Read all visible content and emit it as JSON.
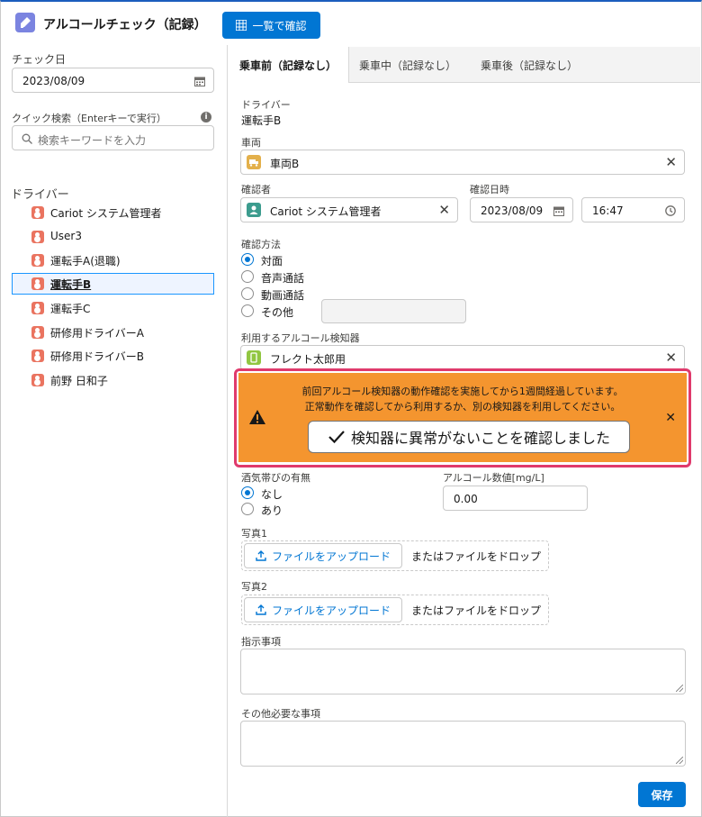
{
  "header": {
    "title": "アルコールチェック（記録）",
    "list_button": "一覧で確認"
  },
  "left": {
    "check_date_label": "チェック日",
    "check_date_value": "2023/08/09",
    "quick_search_label": "クイック検索（Enterキーで実行）",
    "search_placeholder": "検索キーワードを入力",
    "drivers_title": "ドライバー",
    "drivers": [
      {
        "name": "Cariot システム管理者",
        "selected": false
      },
      {
        "name": "User3",
        "selected": false
      },
      {
        "name": "運転手A(退職)",
        "selected": false
      },
      {
        "name": "運転手B",
        "selected": true
      },
      {
        "name": "運転手C",
        "selected": false
      },
      {
        "name": "研修用ドライバーA",
        "selected": false
      },
      {
        "name": "研修用ドライバーB",
        "selected": false
      },
      {
        "name": "前野 日和子",
        "selected": false
      }
    ]
  },
  "tabs": [
    "乗車前（記録なし）",
    "乗車中（記録なし）",
    "乗車後（記録なし）"
  ],
  "form": {
    "driver_label": "ドライバー",
    "driver_value": "運転手B",
    "vehicle_label": "車両",
    "vehicle_value": "車両B",
    "confirmer_label": "確認者",
    "confirmer_value": "Cariot システム管理者",
    "confirm_datetime_label": "確認日時",
    "confirm_date": "2023/08/09",
    "confirm_time": "16:47",
    "method_label": "確認方法",
    "methods": [
      "対面",
      "音声通話",
      "動画通話",
      "その他"
    ],
    "method_selected": "対面",
    "detector_label": "利用するアルコール検知器",
    "detector_value": "フレクト太郎用",
    "warning_line1": "前回アルコール検知器の動作確認を実施してから1週間経過しています。",
    "warning_line2": "正常動作を確認してから利用するか、別の検知器を利用してください。",
    "warning_button": "検知器に異常がないことを確認しました",
    "alcohol_presence_label": "酒気帯びの有無",
    "alcohol_options": [
      "なし",
      "あり"
    ],
    "alcohol_selected": "なし",
    "alcohol_value_label": "アルコール数値[mg/L]",
    "alcohol_value": "0.00",
    "photo1_label": "写真1",
    "photo2_label": "写真2",
    "upload_button": "ファイルをアップロード",
    "drop_text": "またはファイルをドロップ",
    "instructions_label": "指示事項",
    "other_label": "その他必要な事項",
    "save_button": "保存"
  },
  "colors": {
    "brand_blue": "#0176d3",
    "warning_orange": "#f4952f",
    "highlight_border": "#e03a6c",
    "driver_icon": "#ea7460"
  }
}
